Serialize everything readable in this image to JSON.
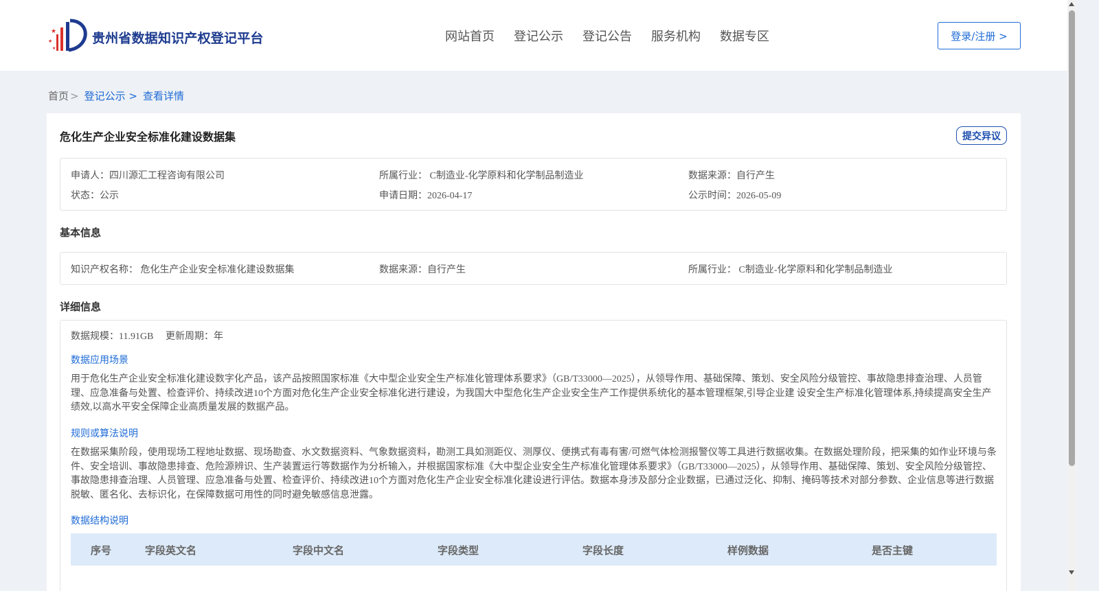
{
  "header": {
    "brand": "贵州省数据知识产权登记平台",
    "nav": [
      "网站首页",
      "登记公示",
      "登记公告",
      "服务机构",
      "数据专区"
    ],
    "login_label": "登录/注册 >"
  },
  "breadcrumb": {
    "home": "首页",
    "sep": ">",
    "items": [
      "登记公示 >",
      "查看详情"
    ]
  },
  "record": {
    "title": "危化生产企业安全标准化建设数据集",
    "objection_label": "提交异议",
    "applicant": "申请人：四川源汇工程咨询有限公司",
    "industry": "所属行业： C制造业-化学原料和化学制品制造业",
    "source": "数据来源：自行产生",
    "status": "状态：公示",
    "apply_date": "申请日期：2026-04-17",
    "publish_date": "公示时间：2026-05-09"
  },
  "basic": {
    "section_title": "基本信息",
    "ip_name": "知识产权名称： 危化生产企业安全标准化建设数据集",
    "source": "数据来源：自行产生",
    "industry": "所属行业： C制造业-化学原料和化学制品制造业"
  },
  "detail": {
    "section_title": "详细信息",
    "scale": "数据规模：11.91GB",
    "cycle": "更新周期：年",
    "scenario_title": "数据应用场景",
    "scenario_text": "用于危化生产企业安全标准化建设数字化产品，该产品按照国家标准《大中型企业安全生产标准化管理体系要求》（GB/T33000—2025），从领导作用、基础保障、策划、安全风险分级管控、事故隐患排查治理、人员管理、应急准备与处置、检查评价、持续改进10个方面对危化生产企业安全标准化进行建设，为我国大中型危化生产企业安全生产工作提供系统化的基本管理框架,引导企业建 设安全生产标准化管理体系,持续提高安全生产绩效,以高水平安全保障企业高质量发展的数据产品。",
    "algo_title": "规则或算法说明",
    "algo_text": "在数据采集阶段，使用现场工程地址数据、现场勘查、水文数据资料、气象数据资料，勘测工具如测距仪、测厚仪、便携式有毒有害/可燃气体检测报警仪等工具进行数据收集。在数据处理阶段，把采集的如作业环境与条件、安全培训、事故隐患排查、危险源辨识、生产装置运行等数据作为分析输入，并根据国家标准《大中型企业安全生产标准化管理体系要求》（GB/T33000—2025），从领导作用、基础保障、策划、安全风险分级管控、事故隐患排查治理、人员管理、应急准备与处置、检查评价、持续改进10个方面对危化生产企业安全标准化建设进行评估。数据本身涉及部分企业数据，已通过泛化、抑制、掩码等技术对部分参数、企业信息等进行数据脱敏、匿名化、去标识化，在保障数据可用性的同时避免敏感信息泄露。",
    "struct_title": "数据结构说明",
    "table_headers": [
      "序号",
      "字段英文名",
      "字段中文名",
      "字段类型",
      "字段长度",
      "样例数据",
      "是否主键"
    ]
  },
  "colors": {
    "accent": "#1e6bd6",
    "brand": "#1d3b8f",
    "table_head_bg": "#ddeaf9"
  }
}
